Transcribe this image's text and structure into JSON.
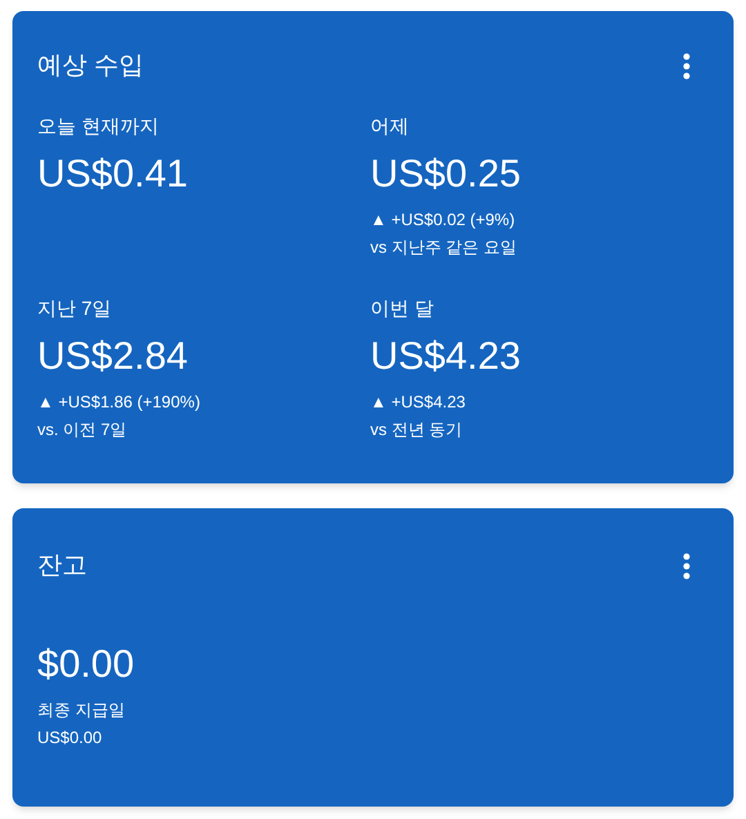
{
  "earnings_card": {
    "title": "예상 수입",
    "metrics": [
      {
        "label": "오늘 현재까지",
        "value": "US$0.41"
      },
      {
        "label": "어제",
        "value": "US$0.25",
        "change": "▲ +US$0.02 (+9%)",
        "comparison": "vs 지난주 같은 요일"
      },
      {
        "label": "지난 7일",
        "value": "US$2.84",
        "change": "▲ +US$1.86 (+190%)",
        "comparison": "vs. 이전 7일"
      },
      {
        "label": "이번 달",
        "value": "US$4.23",
        "change": "▲ +US$4.23",
        "comparison": "vs 전년 동기"
      }
    ]
  },
  "balance_card": {
    "title": "잔고",
    "value": "$0.00",
    "last_payment_label": "최종 지급일",
    "last_payment_value": "US$0.00"
  }
}
